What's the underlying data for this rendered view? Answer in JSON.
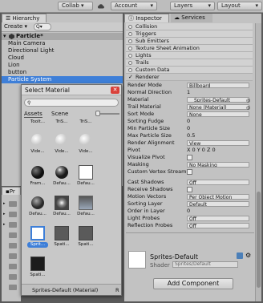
{
  "toolbar": {
    "collab": "Collab ▾",
    "account": "Account",
    "layers": "Layers",
    "layout": "Layout"
  },
  "hierarchy": {
    "tab": "Hierarchy",
    "create": "Create",
    "search_prefix": "Q▾",
    "scene_name": "Particle*",
    "items": [
      "Main Camera",
      "Directional Light",
      "Cloud",
      "Lion",
      "button"
    ],
    "selected_item": "Particle System"
  },
  "project": {
    "tab": "Pr"
  },
  "inspector": {
    "tab": "Inspector",
    "tab2": "Services",
    "sections": [
      "Collision",
      "Triggers",
      "Sub Emitters",
      "Texture Sheet Animation",
      "Lights",
      "Trails",
      "Custom Data"
    ],
    "renderer_header": "Renderer",
    "props": [
      {
        "label": "Render Mode",
        "value": "Billboard",
        "kind": "select"
      },
      {
        "label": "Normal Direction",
        "value": "1",
        "kind": "plain"
      },
      {
        "label": "Material",
        "value": "Sprites-Default",
        "kind": "field"
      },
      {
        "label": "Trail Material",
        "value": "None (Material)",
        "kind": "field"
      },
      {
        "label": "Sort Mode",
        "value": "None",
        "kind": "select"
      },
      {
        "label": "Sorting Fudge",
        "value": "0",
        "kind": "plain"
      },
      {
        "label": "Min Particle Size",
        "value": "0",
        "kind": "plain"
      },
      {
        "label": "Max Particle Size",
        "value": "0.5",
        "kind": "plain"
      },
      {
        "label": "Render Alignment",
        "value": "View",
        "kind": "select"
      },
      {
        "label": "Pivot",
        "value": "X 0  Y 0  Z 0",
        "kind": "plain"
      },
      {
        "label": "Visualize Pivot",
        "value": "",
        "kind": "check"
      },
      {
        "label": "Masking",
        "value": "No Masking",
        "kind": "select"
      },
      {
        "label": "Custom Vertex Stream",
        "value": "",
        "kind": "check"
      },
      {
        "label": "Cast Shadows",
        "value": "Off",
        "kind": "select"
      },
      {
        "label": "Receive Shadows",
        "value": "",
        "kind": "check"
      },
      {
        "label": "Motion Vectors",
        "value": "Per Object Motion",
        "kind": "select"
      },
      {
        "label": "Sorting Layer",
        "value": "Default",
        "kind": "select"
      },
      {
        "label": "Order in Layer",
        "value": "0",
        "kind": "plain"
      },
      {
        "label": "Light Probes",
        "value": "Off",
        "kind": "select"
      },
      {
        "label": "Reflection Probes",
        "value": "Off",
        "kind": "select"
      }
    ],
    "material_name": "Sprites-Default",
    "shader_label": "Shader",
    "shader_value": "Sprites/Default",
    "add_component": "Add Component"
  },
  "select_material": {
    "title": "Select Material",
    "search_placeholder": "",
    "tab_assets": "Assets",
    "tab_scene": "Scene",
    "top_labels": [
      "Toolt...",
      "TriS...",
      "TriS..."
    ],
    "rows": [
      [
        "Vide...",
        "Vide...",
        "Vide..."
      ],
      [
        "Fram...",
        "Defau...",
        "Defau..."
      ],
      [
        "Defau...",
        "Defau...",
        "Defau..."
      ],
      [
        "Sprit...",
        "Spati...",
        "Spati..."
      ],
      [
        "Spati..."
      ]
    ],
    "footer": "Sprites-Default (Material)",
    "footer_right": "R"
  },
  "colors": {
    "accent": "#3e7fd8",
    "selected_row": "#3e7fd8",
    "close_red": "#d9413a"
  }
}
